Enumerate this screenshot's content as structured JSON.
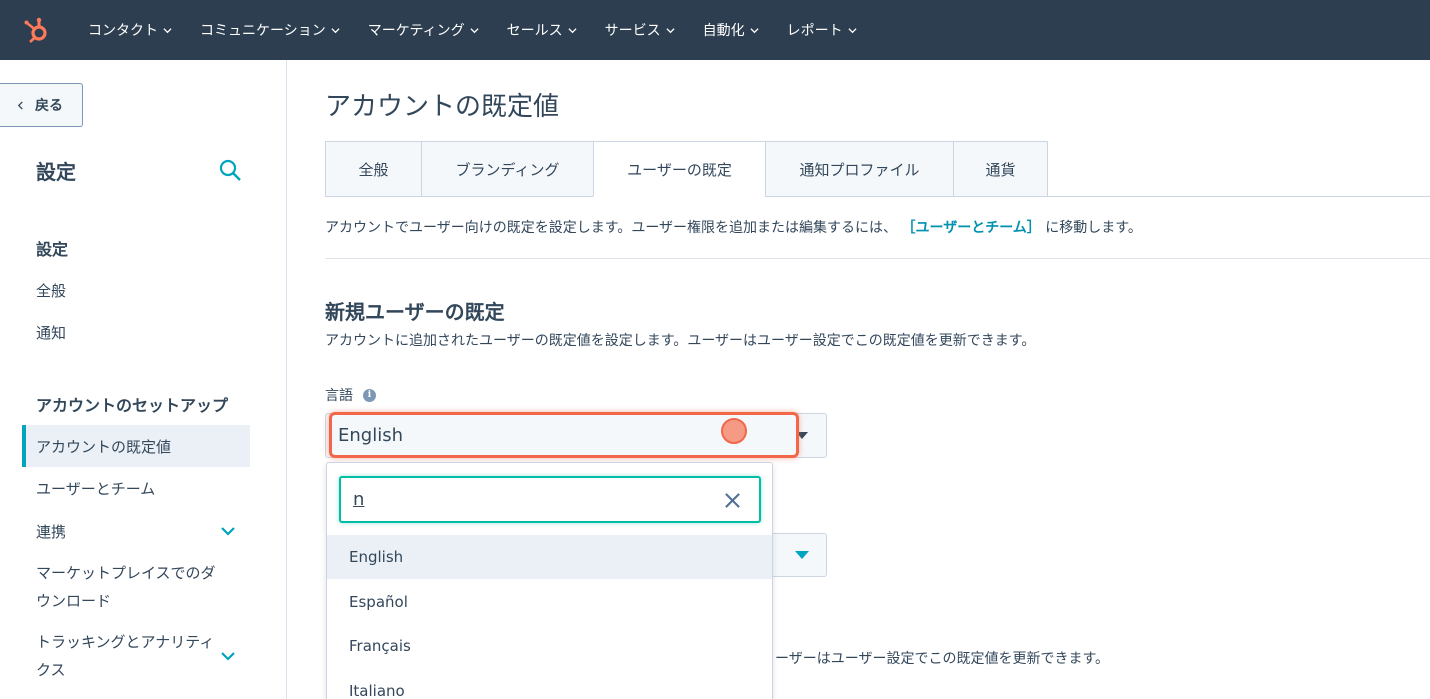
{
  "topnav": {
    "items": [
      {
        "label": "コンタクト"
      },
      {
        "label": "コミュニケーション"
      },
      {
        "label": "マーケティング"
      },
      {
        "label": "セールス"
      },
      {
        "label": "サービス"
      },
      {
        "label": "自動化"
      },
      {
        "label": "レポート"
      }
    ],
    "colors": {
      "bg": "#2d3e50",
      "logo": "#ff7a59"
    }
  },
  "sidebar": {
    "back_label": "戻る",
    "title": "設定",
    "section1": "設定",
    "general": "全般",
    "notifications": "通知",
    "section2": "アカウントのセットアップ",
    "account_defaults": "アカウントの既定値",
    "users_teams": "ユーザーとチーム",
    "integrations": "連携",
    "marketplace": "マーケットプレイスでのダウンロード",
    "tracking": "トラッキングとアナリティクス"
  },
  "main": {
    "title": "アカウントの既定値",
    "tabs": [
      {
        "label": "全般"
      },
      {
        "label": "ブランディング"
      },
      {
        "label": "ユーザーの既定"
      },
      {
        "label": "通知プロファイル"
      },
      {
        "label": "通貨"
      }
    ],
    "intro_before": "アカウントでユーザー向けの既定を設定します。ユーザー権限を追加または編集するには、",
    "intro_link": "［ユーザーとチーム］",
    "intro_after": "に移動します。",
    "section_title": "新規ユーザーの既定",
    "section_desc": "アカウントに追加されたユーザーの既定値を設定します。ユーザーはユーザー設定でこの既定値を更新できます。",
    "language_label": "言語",
    "language_value": "English",
    "desc2_partial": "ーザーはユーザー設定でこの既定値を更新できます。"
  },
  "dropdown": {
    "search_value": "n",
    "options": [
      {
        "label": "English"
      },
      {
        "label": "Español"
      },
      {
        "label": "Français"
      },
      {
        "label": "Italiano"
      }
    ]
  }
}
